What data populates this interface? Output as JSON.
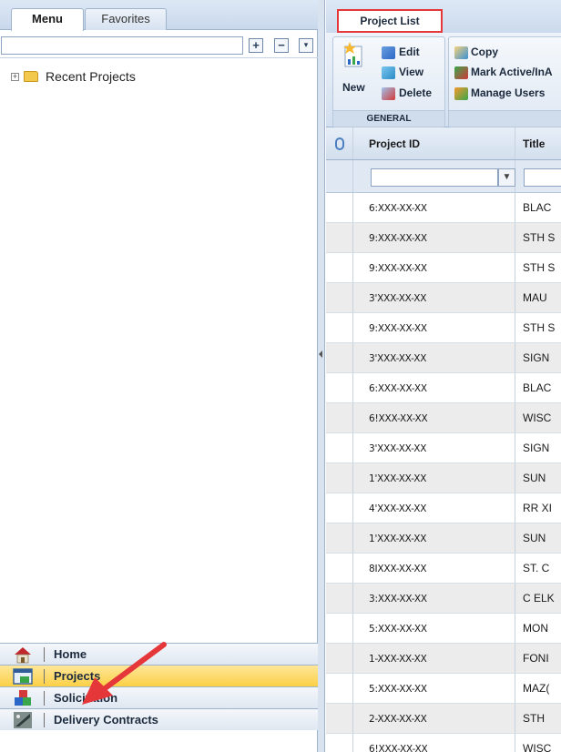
{
  "left_panel": {
    "tabs": [
      {
        "label": "Menu",
        "active": true
      },
      {
        "label": "Favorites",
        "active": false
      }
    ],
    "search": {
      "value": "",
      "placeholder": ""
    },
    "toolbar_buttons": [
      "+",
      "−",
      "▾"
    ],
    "tree": [
      {
        "label": "Recent Projects",
        "icon": "folder-icon",
        "expandable": true
      }
    ],
    "nav": [
      {
        "label": "Home",
        "icon": "home-icon",
        "active": false
      },
      {
        "label": "Projects",
        "icon": "projects-icon",
        "active": true
      },
      {
        "label": "Solicitation",
        "icon": "solicitation-icon",
        "active": false
      },
      {
        "label": "Delivery Contracts",
        "icon": "delivery-contracts-icon",
        "active": false
      }
    ]
  },
  "ribbon": {
    "tab": "Project List",
    "general_group": {
      "label": "GENERAL",
      "new_label": "New",
      "edit_label": "Edit",
      "view_label": "View",
      "delete_label": "Delete"
    },
    "other_group": {
      "copy_label": "Copy",
      "mark_active_label": "Mark Active/InA",
      "manage_users_label": "Manage Users"
    }
  },
  "grid": {
    "columns": {
      "attachment_icon": "paperclip-icon",
      "project_id": "Project ID",
      "title": "Title"
    },
    "filter_icon": "filter-icon",
    "rows": [
      {
        "id": "6:XXX-XX-XX",
        "title": "BLAC"
      },
      {
        "id": "9:XXX-XX-XX",
        "title": "STH S"
      },
      {
        "id": "9:XXX-XX-XX",
        "title": "STH S"
      },
      {
        "id": "3'XXX-XX-XX",
        "title": "MAU"
      },
      {
        "id": "9:XXX-XX-XX",
        "title": "STH S"
      },
      {
        "id": "3'XXX-XX-XX",
        "title": "SIGN"
      },
      {
        "id": "6:XXX-XX-XX",
        "title": "BLAC"
      },
      {
        "id": "6!XXX-XX-XX",
        "title": "WISC"
      },
      {
        "id": "3'XXX-XX-XX",
        "title": "SIGN"
      },
      {
        "id": "1'XXX-XX-XX",
        "title": "SUN"
      },
      {
        "id": "4'XXX-XX-XX",
        "title": "RR XI"
      },
      {
        "id": "1'XXX-XX-XX",
        "title": "SUN"
      },
      {
        "id": "8IXXX-XX-XX",
        "title": "ST. C"
      },
      {
        "id": "3:XXX-XX-XX",
        "title": "C ELK"
      },
      {
        "id": "5:XXX-XX-XX",
        "title": "MON"
      },
      {
        "id": "1-XXX-XX-XX",
        "title": "FONI"
      },
      {
        "id": "5:XXX-XX-XX",
        "title": "MAZ("
      },
      {
        "id": "2-XXX-XX-XX",
        "title": "STH"
      },
      {
        "id": "6!XXX-XX-XX",
        "title": "WISC"
      }
    ]
  },
  "colors": {
    "highlight_red": "#e5373a",
    "active_nav": "#fbd045",
    "row_alt": "#ececec"
  }
}
